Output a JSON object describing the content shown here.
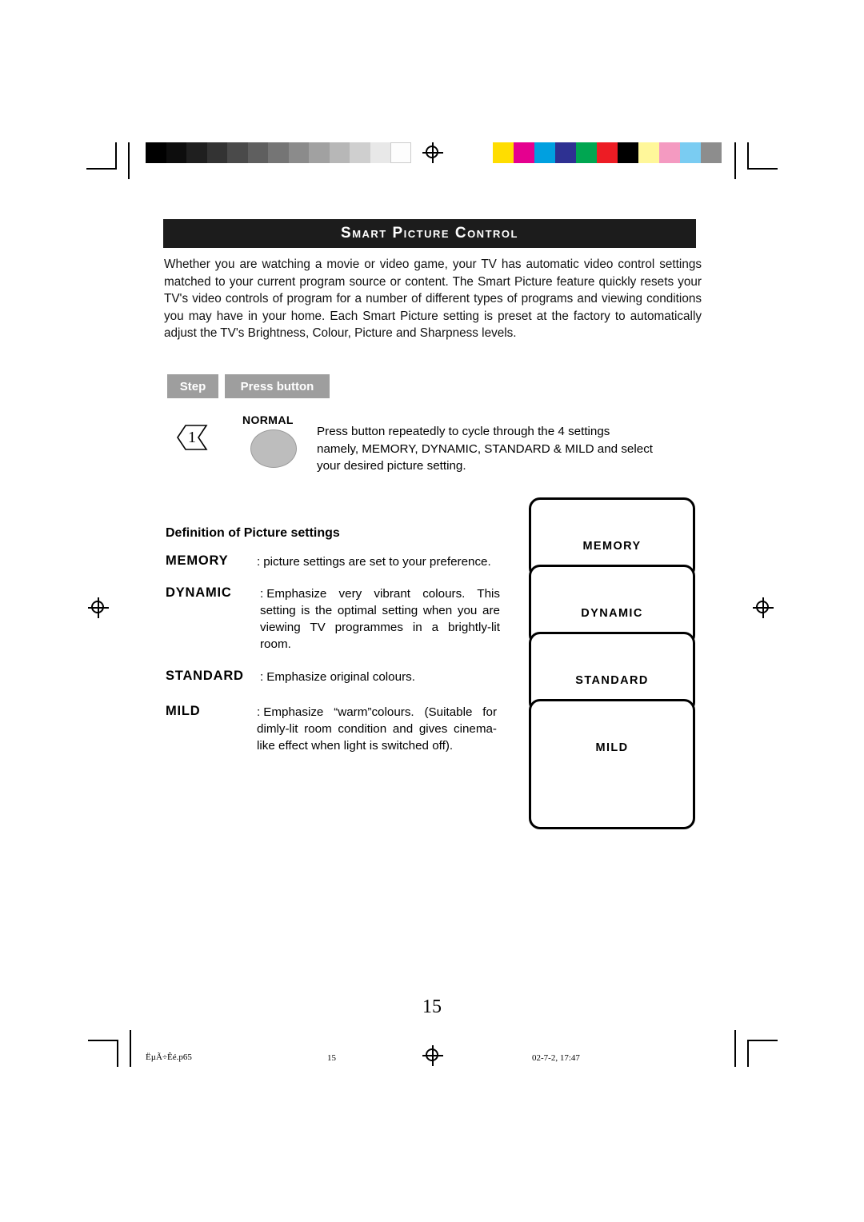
{
  "document": {
    "title": "Smart Picture Control",
    "intro": "Whether you are watching a movie or video game, your TV has automatic video control settings matched to your current program source or content. The Smart Picture feature quickly resets your TV's video controls of program for a number of different types of programs and viewing conditions you may have in your home. Each Smart Picture setting is preset at the factory to automatically adjust the TV's Brightness, Colour, Picture and Sharpness levels.",
    "page_number": "15"
  },
  "table": {
    "headers": {
      "step": "Step",
      "press_button": "Press button"
    },
    "rows": [
      {
        "step_number": "1",
        "button_label": "NORMAL",
        "instruction": "Press button repeatedly to cycle through the 4 settings namely, MEMORY, DYNAMIC, STANDARD & MILD and select your desired picture setting."
      }
    ]
  },
  "definitions": {
    "heading": "Definition of Picture settings",
    "items": [
      {
        "term": "MEMORY",
        "colon": ":",
        "description": "picture settings are set to your preference."
      },
      {
        "term": "DYNAMIC",
        "colon": ":",
        "description": "Emphasize very vibrant colours. This setting is the optimal setting when you are viewing TV programmes in a brightly-lit room."
      },
      {
        "term": "STANDARD",
        "colon": ":",
        "description": "Emphasize original colours."
      },
      {
        "term": "MILD",
        "colon": ":",
        "description": "Emphasize “warm”colours. (Suitable for dimly-lit room condition and gives cinema-like effect when light is switched off)."
      }
    ]
  },
  "settings_panel": {
    "options": [
      "MEMORY",
      "DYNAMIC",
      "STANDARD",
      "MILD"
    ]
  },
  "print_footer": {
    "file_name": "ËµÃ÷Êé.p65",
    "page": "15",
    "date": "02-7-2, 17:47"
  },
  "print_marks": {
    "grayscale_wedge": [
      "#000000",
      "#111111",
      "#222222",
      "#333333",
      "#444444",
      "#5a5a5a",
      "#6f6f6f",
      "#868686",
      "#9d9d9d",
      "#b4b4b4",
      "#cbcbcb",
      "#e2e2e2",
      "#f5f5f5"
    ],
    "color_bar": [
      "#ffdd00",
      "#e5008f",
      "#00a0e0",
      "#2e3192",
      "#00a651",
      "#ed1c24",
      "#000000",
      "#fff79a",
      "#f49ac1",
      "#7accf2",
      "#8d8d8d"
    ]
  }
}
